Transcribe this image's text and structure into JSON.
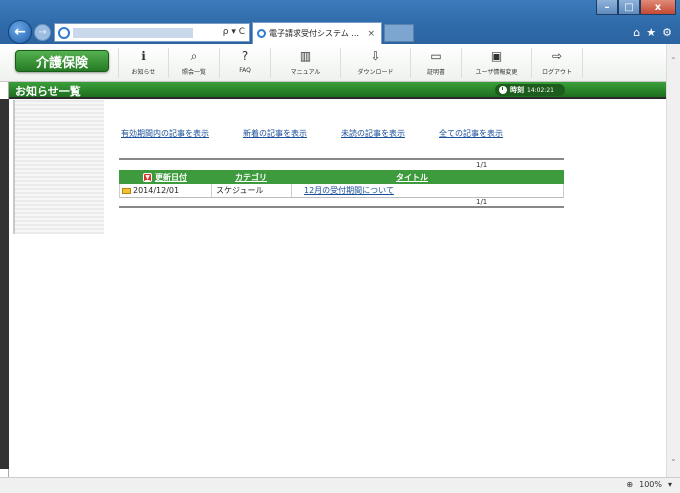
{
  "browser": {
    "tab_title": "電子請求受付システム ...",
    "tab_close": "×",
    "addr_tools": "ρ ▾ C",
    "back_icon": "arrow-left-icon",
    "forward_icon": "arrow-right-icon",
    "window_buttons": {
      "minimize": "–",
      "maximize": "□",
      "close": "x"
    },
    "chrome_icons": {
      "home": "⌂",
      "favorites": "★",
      "tools": "⚙"
    },
    "zoom": "100%"
  },
  "app": {
    "logo": "介護保険",
    "menu": [
      {
        "label": "お知らせ",
        "icon": "info-icon"
      },
      {
        "label": "照会一覧",
        "icon": "search-icon"
      },
      {
        "label": "FAQ",
        "icon": "faq-icon"
      },
      {
        "label": "マニュアル",
        "icon": "manual-icon"
      },
      {
        "label": "ダウンロード",
        "icon": "download-icon"
      },
      {
        "label": "証明書",
        "icon": "certificate-icon"
      },
      {
        "label": "ユーザ情報変更",
        "icon": "user-info-icon"
      },
      {
        "label": "ログアウト",
        "icon": "logout-icon"
      }
    ],
    "page_title": "お知らせ一覧",
    "clock": {
      "label": "時刻",
      "time": "14:02:21"
    },
    "colors": {
      "green": "#2e8b2e",
      "link": "#1a4f9a"
    }
  },
  "main": {
    "filters": [
      "有効期間内の記事を表示",
      "新着の記事を表示",
      "未読の記事を表示",
      "全ての記事を表示"
    ],
    "pager": "1/1",
    "columns": {
      "date": "更新日付",
      "category": "カテゴリ",
      "title": "タイトル"
    },
    "rows": [
      {
        "date": "2014/12/01",
        "category": "スケジュール",
        "title": "12月の受付期間について"
      }
    ]
  }
}
